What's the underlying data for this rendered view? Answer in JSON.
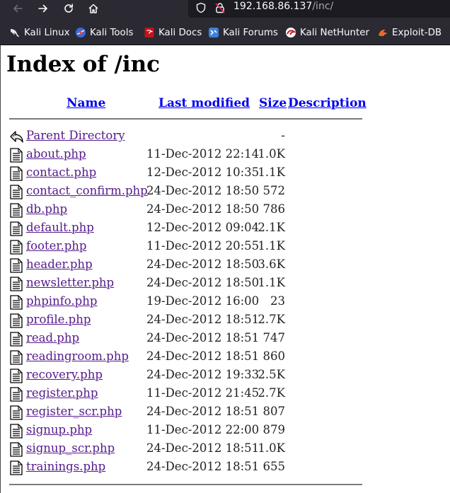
{
  "browser": {
    "url_host": "192.168.86.137",
    "url_path": "/inc/"
  },
  "bookmarks": [
    {
      "label": "Kali Linux",
      "icon": "kali-dragon-icon"
    },
    {
      "label": "Kali Tools",
      "icon": "kali-tools-icon"
    },
    {
      "label": "Kali Docs",
      "icon": "kali-docs-icon"
    },
    {
      "label": "Kali Forums",
      "icon": "kali-forums-icon"
    },
    {
      "label": "Kali NetHunter",
      "icon": "nethunter-icon"
    },
    {
      "label": "Exploit-DB",
      "icon": "exploit-db-icon"
    }
  ],
  "page": {
    "title": "Index of /inc",
    "columns": {
      "name": "Name",
      "modified": "Last modified",
      "size": "Size",
      "description": "Description"
    },
    "parent": {
      "label": "Parent Directory",
      "size": "-"
    },
    "files": [
      {
        "name": "about.php",
        "modified": "11-Dec-2012 22:14",
        "size": "1.0K"
      },
      {
        "name": "contact.php",
        "modified": "12-Dec-2012 10:35",
        "size": "1.1K"
      },
      {
        "name": "contact_confirm.php",
        "modified": "24-Dec-2012 18:50",
        "size": "572"
      },
      {
        "name": "db.php",
        "modified": "24-Dec-2012 18:50",
        "size": "786"
      },
      {
        "name": "default.php",
        "modified": "12-Dec-2012 09:04",
        "size": "2.1K"
      },
      {
        "name": "footer.php",
        "modified": "11-Dec-2012 20:55",
        "size": "1.1K"
      },
      {
        "name": "header.php",
        "modified": "24-Dec-2012 18:50",
        "size": "3.6K"
      },
      {
        "name": "newsletter.php",
        "modified": "24-Dec-2012 18:50",
        "size": "1.1K"
      },
      {
        "name": "phpinfo.php",
        "modified": "19-Dec-2012 16:00",
        "size": "23"
      },
      {
        "name": "profile.php",
        "modified": "24-Dec-2012 18:51",
        "size": "2.7K"
      },
      {
        "name": "read.php",
        "modified": "24-Dec-2012 18:51",
        "size": "747"
      },
      {
        "name": "readingroom.php",
        "modified": "24-Dec-2012 18:51",
        "size": "860"
      },
      {
        "name": "recovery.php",
        "modified": "24-Dec-2012 19:33",
        "size": "2.5K"
      },
      {
        "name": "register.php",
        "modified": "11-Dec-2012 21:45",
        "size": "2.7K"
      },
      {
        "name": "register_scr.php",
        "modified": "24-Dec-2012 18:51",
        "size": "807"
      },
      {
        "name": "signup.php",
        "modified": "11-Dec-2012 22:00",
        "size": "879"
      },
      {
        "name": "signup_scr.php",
        "modified": "24-Dec-2012 18:51",
        "size": "1.0K"
      },
      {
        "name": "trainings.php",
        "modified": "24-Dec-2012 18:51",
        "size": "655"
      }
    ]
  }
}
